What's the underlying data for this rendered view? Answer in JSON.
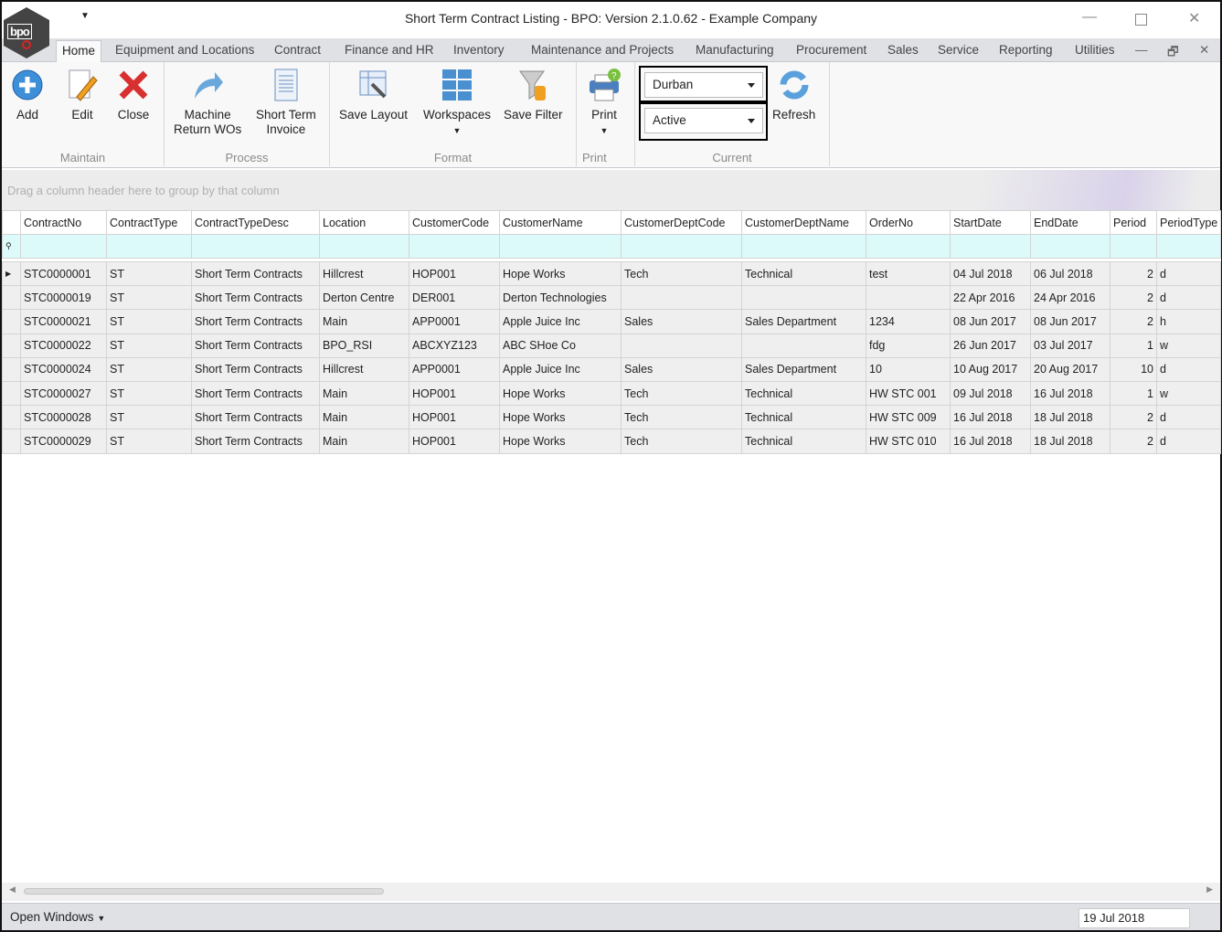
{
  "window": {
    "title": "Short Term Contract Listing - BPO: Version 2.1.0.62 - Example Company",
    "logo_text": "bpo"
  },
  "tabs": [
    "Home",
    "Equipment and Locations",
    "Contract",
    "Finance and HR",
    "Inventory",
    "Maintenance and Projects",
    "Manufacturing",
    "Procurement",
    "Sales",
    "Service",
    "Reporting",
    "Utilities"
  ],
  "ribbon": {
    "maintain": {
      "label": "Maintain",
      "add": "Add",
      "edit": "Edit",
      "close": "Close"
    },
    "process": {
      "label": "Process",
      "machine1": "Machine",
      "machine2": "Return WOs",
      "stinv1": "Short Term",
      "stinv2": "Invoice"
    },
    "format": {
      "label": "Format",
      "save_layout": "Save Layout",
      "workspaces": "Workspaces",
      "save_filter": "Save Filter"
    },
    "print": {
      "label": "Print",
      "print": "Print"
    },
    "current": {
      "label": "Current",
      "location": "Durban",
      "status": "Active",
      "refresh": "Refresh"
    }
  },
  "grid": {
    "group_hint": "Drag a column header here to group by that column",
    "columns": [
      "ContractNo",
      "ContractType",
      "ContractTypeDesc",
      "Location",
      "CustomerCode",
      "CustomerName",
      "CustomerDeptCode",
      "CustomerDeptName",
      "OrderNo",
      "StartDate",
      "EndDate",
      "Period",
      "PeriodType"
    ],
    "rows": [
      [
        "STC0000001",
        "ST",
        "Short Term Contracts",
        "Hillcrest",
        "HOP001",
        "Hope Works",
        "Tech",
        "Technical",
        "test",
        "04 Jul 2018",
        "06 Jul 2018",
        "2",
        "d"
      ],
      [
        "STC0000019",
        "ST",
        "Short Term Contracts",
        "Derton Centre",
        "DER001",
        "Derton Technologies",
        "",
        "",
        "",
        "22 Apr 2016",
        "24 Apr 2016",
        "2",
        "d"
      ],
      [
        "STC0000021",
        "ST",
        "Short Term Contracts",
        "Main",
        "APP0001",
        "Apple Juice Inc",
        "Sales",
        "Sales Department",
        "1234",
        "08 Jun 2017",
        "08 Jun 2017",
        "2",
        "h"
      ],
      [
        "STC0000022",
        "ST",
        "Short Term Contracts",
        "BPO_RSI",
        "ABCXYZ123",
        "ABC SHoe Co",
        "",
        "",
        "fdg",
        "26 Jun 2017",
        "03 Jul 2017",
        "1",
        "w"
      ],
      [
        "STC0000024",
        "ST",
        "Short Term Contracts",
        "Hillcrest",
        "APP0001",
        "Apple Juice Inc",
        "Sales",
        "Sales Department",
        "10",
        "10 Aug 2017",
        "20 Aug 2017",
        "10",
        "d"
      ],
      [
        "STC0000027",
        "ST",
        "Short Term Contracts",
        "Main",
        "HOP001",
        "Hope Works",
        "Tech",
        "Technical",
        "HW STC 001",
        "09 Jul 2018",
        "16 Jul 2018",
        "1",
        "w"
      ],
      [
        "STC0000028",
        "ST",
        "Short Term Contracts",
        "Main",
        "HOP001",
        "Hope Works",
        "Tech",
        "Technical",
        "HW STC 009",
        "16 Jul 2018",
        "18 Jul 2018",
        "2",
        "d"
      ],
      [
        "STC0000029",
        "ST",
        "Short Term Contracts",
        "Main",
        "HOP001",
        "Hope Works",
        "Tech",
        "Technical",
        "HW STC 010",
        "16 Jul 2018",
        "18 Jul 2018",
        "2",
        "d"
      ]
    ]
  },
  "status": {
    "open_windows": "Open Windows",
    "date": "19 Jul 2018"
  }
}
